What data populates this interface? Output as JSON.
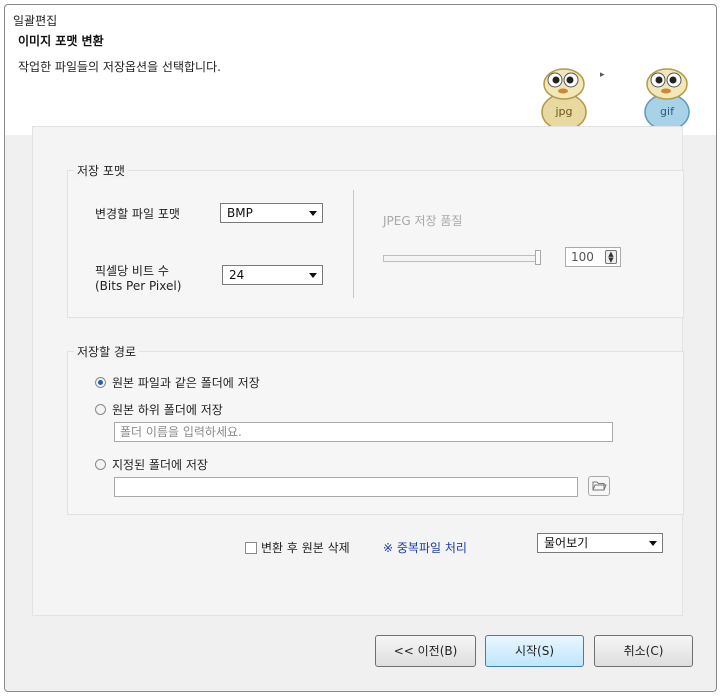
{
  "window": {
    "title": "일괄편집"
  },
  "header": {
    "title": "이미지 포맷 변환",
    "subtitle": "작업한 파일들의 저장옵션을 선택합니다.",
    "mascot_left": "jpg",
    "mascot_right": "gif",
    "arrow": "▸"
  },
  "save_format": {
    "group_title": "저장 포맷",
    "file_format_label": "변경할 파일 포맷",
    "file_format_value": "BMP",
    "bpp_label_line1": "픽셀당 비트 수",
    "bpp_label_line2": "(Bits Per Pixel)",
    "bpp_value": "24",
    "jpeg_quality_label": "JPEG 저장 품질",
    "jpeg_quality_value": "100",
    "jpeg_quality_slider_fraction": 1.0
  },
  "save_path": {
    "group_title": "저장할 경로",
    "option_same": "원본 파일과 같은 폴더에 저장",
    "option_sub": "원본 하위 폴더에 저장",
    "subfolder_placeholder": "폴더 이름을 입력하세요.",
    "option_custom": "지정된 폴더에 저장",
    "custom_path_value": "",
    "selected": "same"
  },
  "options": {
    "delete_original_label": "변환 후 원본 삭제",
    "delete_original_checked": false,
    "duplicate_label": "※ 중복파일 처리",
    "duplicate_value": "물어보기"
  },
  "buttons": {
    "prev": "<< 이전(B)",
    "start": "시작(S)",
    "cancel": "취소(C)"
  },
  "colors": {
    "accent": "#2b5ea8",
    "link": "#1a3cb0",
    "primary_button": "#bee6fd"
  }
}
